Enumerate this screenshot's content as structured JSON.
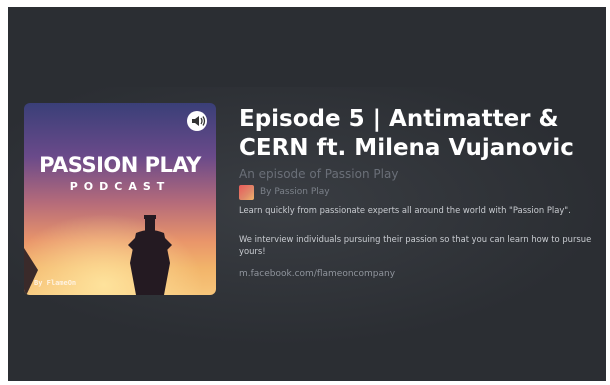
{
  "artwork": {
    "title_line1": "PASSION PLAY",
    "title_line2": "PODCAST",
    "credit": "By FlameOn"
  },
  "episode": {
    "title": "Episode 5 | Antimatter & CERN ft. Milena Vujanovic",
    "subtitle": "An episode of Passion Play",
    "byline": "By Passion Play",
    "description_1": "Learn quickly from passionate experts all around the world with \"Passion Play\".",
    "description_2": "We interview individuals pursuing their passion so that you can learn how to pursue yours!",
    "link": "m.facebook.com/flameoncompany"
  },
  "icons": {
    "speaker": "speaker-icon"
  },
  "colors": {
    "background": "#2b2e33",
    "title": "#ffffff",
    "subtitle": "#6a6f78",
    "body_text": "#c9ccd1",
    "link": "#8f949c"
  }
}
